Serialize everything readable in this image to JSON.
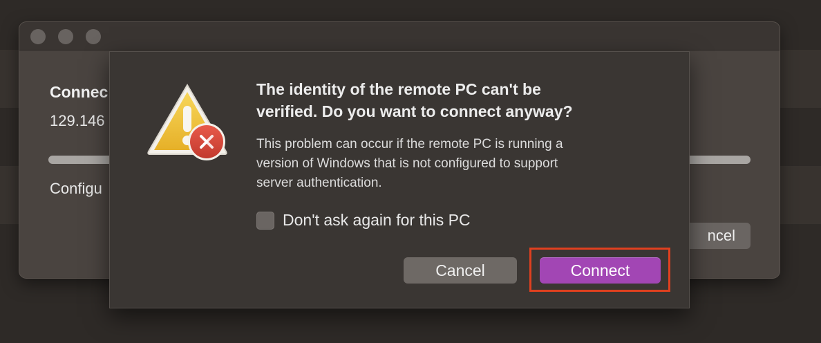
{
  "background_window": {
    "heading": "Connec",
    "address": "129.146",
    "status": "Configu",
    "cancel_label": "ncel",
    "progress": 1.0
  },
  "alert": {
    "title_line1": "The identity of the remote PC can't be",
    "title_line2": "verified. Do you want to connect anyway?",
    "body_line1": "This problem can occur if the remote PC is running a",
    "body_line2": "version of Windows that is not configured to support",
    "body_line3": "server authentication.",
    "checkbox_label": "Don't ask again for this PC",
    "checkbox_checked": false,
    "cancel_label": "Cancel",
    "connect_label": "Connect",
    "icon": "warning-remote-desktop-icon"
  },
  "colors": {
    "accent": "#a246b4",
    "highlight": "#e0401f",
    "warning": "#f2c23a",
    "badge": "#d9483b"
  }
}
